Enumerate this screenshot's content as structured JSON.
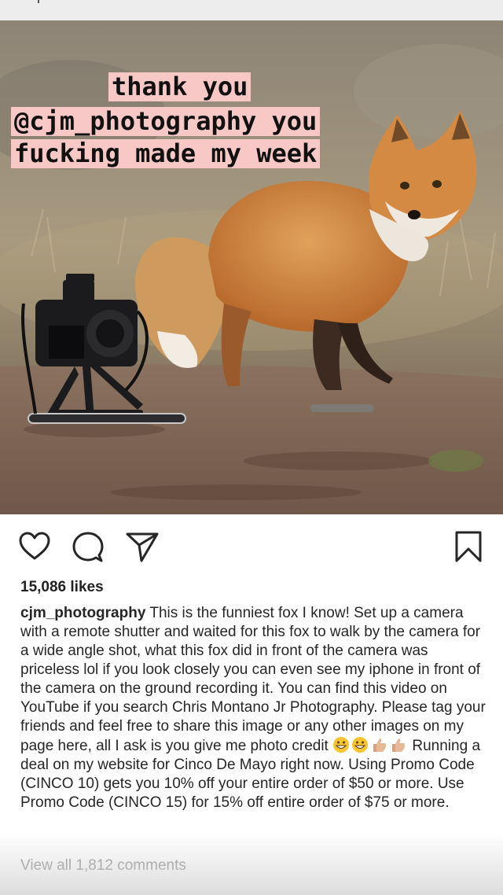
{
  "story": {
    "overlay_lines": [
      "thank you",
      "@cjm_photography you",
      "fucking made my week"
    ],
    "overlay_bg_color": "#f7c8c5"
  },
  "post": {
    "likes": "15,086 likes",
    "username": "cjm_photography",
    "caption_text": " This is the funniest fox I know! Set up a camera with a remote shutter and waited for this fox to walk by the camera for a wide angle shot, what this fox did in front of the camera was priceless lol if you look closely you can even see my iphone in front of the camera on the ground recording it. You can find this video on YouTube if you search Chris Montano Jr Photography. Please tag your friends and feel free to share this image or any other images on my page here, all I ask is you give me photo credit ",
    "caption_emojis": [
      "grinning-face-emoji",
      "grinning-face-emoji",
      "thumbs-up-emoji",
      "thumbs-up-emoji"
    ],
    "caption_text_2": " Running a deal on my website for Cinco De Mayo right now. Using Promo Code (CINCO 10) gets you 10% off your entire order of $50 or more. Use Promo Code (CINCO 15) for 15% off entire order of $75 or more.",
    "view_all_comments": "View all 1,812 comments"
  },
  "icons": {
    "like": "heart-icon",
    "comment": "comment-icon",
    "share": "paper-plane-icon",
    "save": "bookmark-icon"
  }
}
